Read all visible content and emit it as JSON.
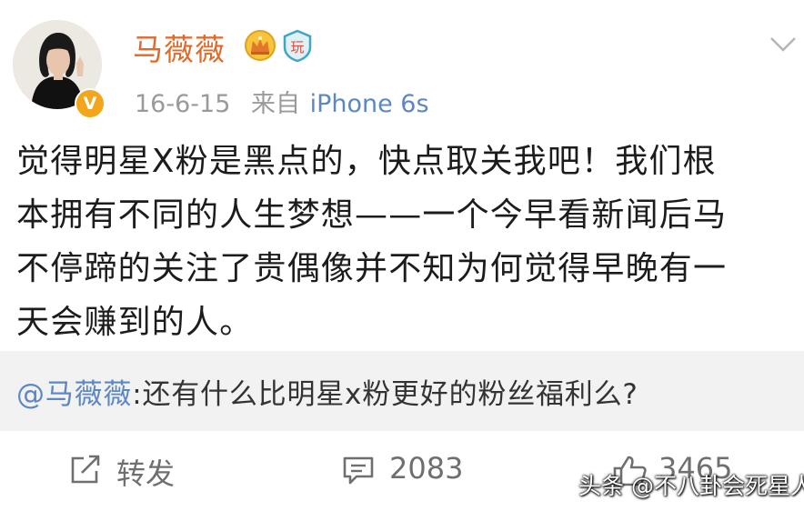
{
  "post": {
    "username": "马薇薇",
    "verified_badge": "V",
    "crown_icon": "crown-icon",
    "rank_icon_text": "玩",
    "date": "16-6-15",
    "via": "来自",
    "device": "iPhone 6s",
    "body_lines": [
      "觉得明星X粉是黑点的，快点取关我吧！我们根",
      "本拥有不同的人生梦想——一个今早看新闻后马",
      "不停蹄的关注了贵偶像并不知为何觉得早晚有一",
      "天会赚到的人。"
    ]
  },
  "repost": {
    "mention": "@马薇薇",
    "text": ":还有什么比明星x粉更好的粉丝福利么?"
  },
  "actions": {
    "repost_label": "转发",
    "comment_count": "2083",
    "like_count": "3465"
  },
  "watermark": "头条 @不八卦会死星人",
  "colors": {
    "username": "#e26a28",
    "link": "#5b87c5",
    "meta": "#9a9a9a",
    "repost_bg": "#f2f2f2"
  }
}
